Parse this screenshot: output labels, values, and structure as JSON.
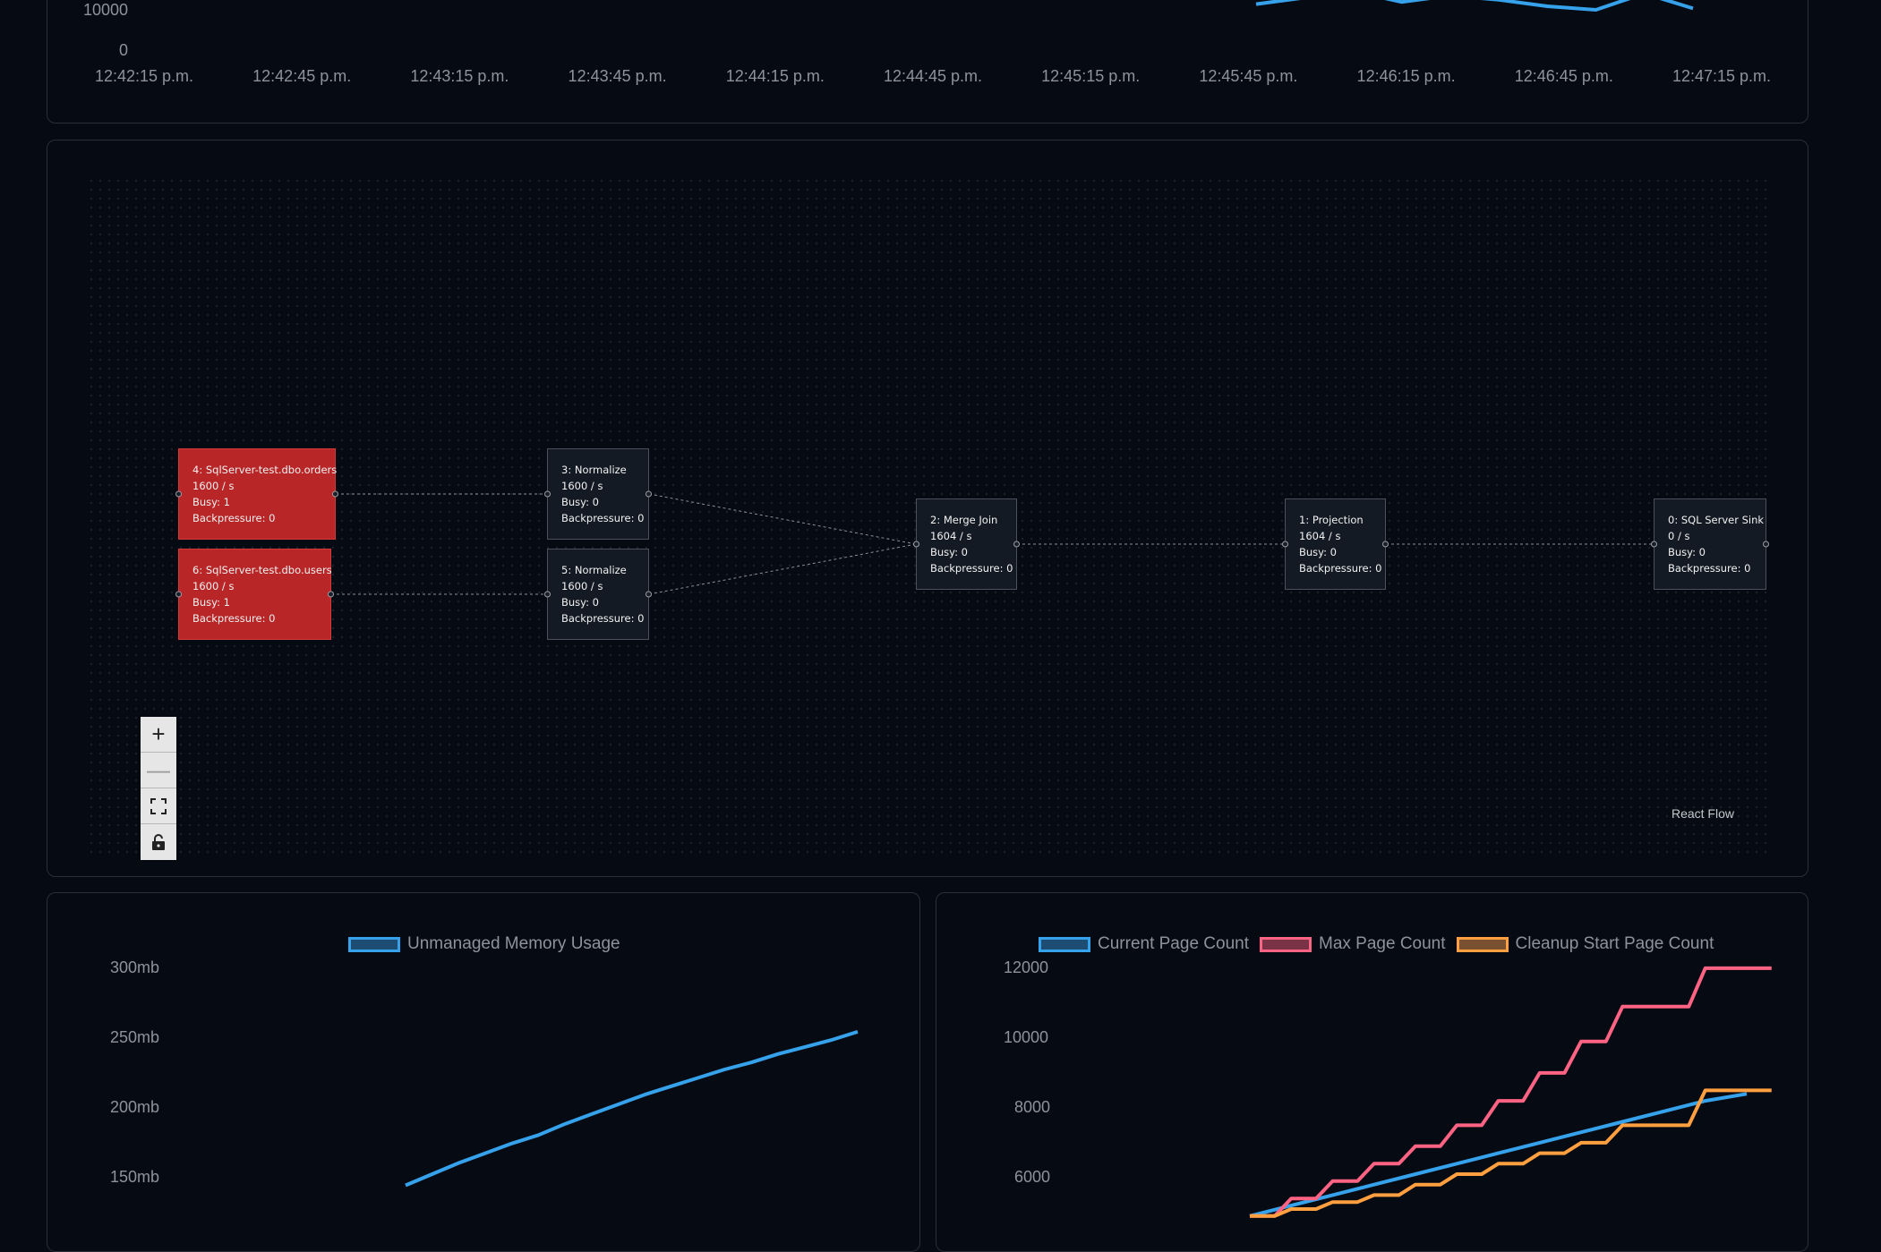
{
  "top_chart": {
    "y_ticks": [
      "10000",
      "0"
    ],
    "x_ticks": [
      "12:42:15 p.m.",
      "12:42:45 p.m.",
      "12:43:15 p.m.",
      "12:43:45 p.m.",
      "12:44:15 p.m.",
      "12:44:45 p.m.",
      "12:45:15 p.m.",
      "12:45:45 p.m.",
      "12:46:15 p.m.",
      "12:46:45 p.m.",
      "12:47:15 p.m."
    ],
    "line_color": "#36a2eb"
  },
  "flow": {
    "nodes": [
      {
        "id": "n4",
        "title": "4: SqlServer-test.dbo.orders",
        "rate": "1600 / s",
        "busy": "Busy: 1",
        "backpressure": "Backpressure: 0",
        "status": "hot"
      },
      {
        "id": "n6",
        "title": "6: SqlServer-test.dbo.users",
        "rate": "1600 / s",
        "busy": "Busy: 1",
        "backpressure": "Backpressure: 0",
        "status": "hot"
      },
      {
        "id": "n3",
        "title": "3: Normalize",
        "rate": "1600 / s",
        "busy": "Busy: 0",
        "backpressure": "Backpressure: 0",
        "status": "normal"
      },
      {
        "id": "n5",
        "title": "5: Normalize",
        "rate": "1600 / s",
        "busy": "Busy: 0",
        "backpressure": "Backpressure: 0",
        "status": "normal"
      },
      {
        "id": "n2",
        "title": "2: Merge Join",
        "rate": "1604 / s",
        "busy": "Busy: 0",
        "backpressure": "Backpressure: 0",
        "status": "normal"
      },
      {
        "id": "n1",
        "title": "1: Projection",
        "rate": "1604 / s",
        "busy": "Busy: 0",
        "backpressure": "Backpressure: 0",
        "status": "normal"
      },
      {
        "id": "n0",
        "title": "0: SQL Server Sink",
        "rate": "0 / s",
        "busy": "Busy: 0",
        "backpressure": "Backpressure: 0",
        "status": "normal"
      }
    ],
    "edges": [
      [
        "n4",
        "n3"
      ],
      [
        "n6",
        "n5"
      ],
      [
        "n3",
        "n2"
      ],
      [
        "n5",
        "n2"
      ],
      [
        "n2",
        "n1"
      ],
      [
        "n1",
        "n0"
      ]
    ],
    "controls": {
      "zoom_in": "+",
      "zoom_out": "—",
      "fit_view": "⛶",
      "lock": "🔓"
    },
    "attribution": "React Flow"
  },
  "memory_chart": {
    "legend": "Unmanaged Memory Usage",
    "color": "#36a2eb",
    "y_ticks": [
      "300mb",
      "250mb",
      "200mb",
      "150mb"
    ]
  },
  "page_chart": {
    "legend": [
      "Current Page Count",
      "Max Page Count",
      "Cleanup Start Page Count"
    ],
    "colors": [
      "#36a2eb",
      "#ff6384",
      "#ff9f40"
    ],
    "y_ticks": [
      "12000",
      "10000",
      "8000",
      "6000"
    ]
  },
  "chart_data": [
    {
      "type": "line",
      "title": "",
      "xlabel": "",
      "ylabel": "",
      "x": [
        "12:42:15 p.m.",
        "12:42:45 p.m.",
        "12:43:15 p.m.",
        "12:43:45 p.m.",
        "12:44:15 p.m.",
        "12:44:45 p.m.",
        "12:45:15 p.m.",
        "12:45:45 p.m.",
        "12:46:15 p.m.",
        "12:46:45 p.m.",
        "12:47:15 p.m."
      ],
      "ylim": [
        0,
        10000
      ],
      "series": [
        {
          "values": [
            10600,
            10900,
            11200,
            10700,
            11000,
            10800,
            10500,
            10300,
            11100,
            10400
          ]
        }
      ],
      "grid": false
    },
    {
      "type": "line",
      "title": "",
      "ylim": [
        150,
        300
      ],
      "y_unit": "mb",
      "series": [
        {
          "name": "Unmanaged Memory Usage",
          "values": [
            142,
            150,
            158,
            165,
            172,
            178,
            186,
            193,
            200,
            207,
            213,
            219,
            225,
            230,
            236,
            241,
            246,
            252
          ]
        }
      ],
      "legend": "top"
    },
    {
      "type": "line",
      "title": "",
      "ylim": [
        6000,
        12000
      ],
      "series": [
        {
          "name": "Current Page Count",
          "values": [
            4800,
            5100,
            5400,
            5700,
            6000,
            6300,
            6600,
            6900,
            7200,
            7500,
            7800,
            8100,
            8300
          ]
        },
        {
          "name": "Max Page Count",
          "values": [
            4800,
            5300,
            5800,
            6300,
            6800,
            7400,
            8100,
            8900,
            9800,
            10800,
            10800,
            11900,
            11900
          ]
        },
        {
          "name": "Cleanup Start Page Count",
          "values": [
            4800,
            5000,
            5200,
            5400,
            5700,
            6000,
            6300,
            6600,
            6900,
            7400,
            7400,
            8400,
            8400
          ]
        }
      ],
      "legend": "top"
    }
  ]
}
